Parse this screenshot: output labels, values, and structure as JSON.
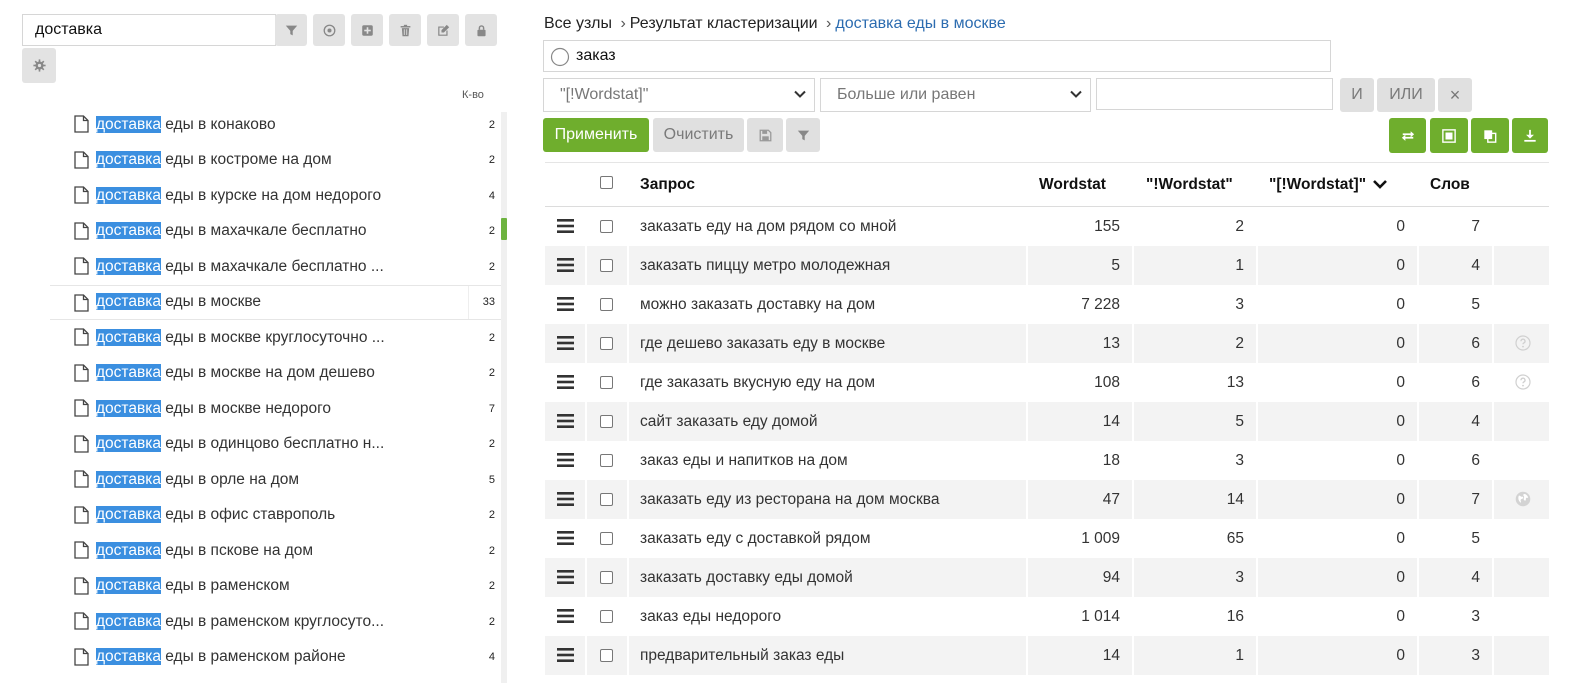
{
  "left_panel": {
    "search_value": "доставка",
    "toolbar_icons": [
      "filter-icon",
      "target-icon",
      "add-icon",
      "trash-icon",
      "edit-icon",
      "lock-icon",
      "gear-icon"
    ],
    "count_header": "К-во",
    "highlight_term": "доставка",
    "items": [
      {
        "rest": " еды в конаково",
        "count": "2"
      },
      {
        "rest": " еды в костроме на дом",
        "count": "2"
      },
      {
        "rest": " еды в курске на дом недорого",
        "count": "4"
      },
      {
        "rest": " еды в махачкале бесплатно",
        "count": "2"
      },
      {
        "rest": " еды в махачкале бесплатно ...",
        "count": "2"
      },
      {
        "rest": " еды в москве",
        "count": "33",
        "selected": true
      },
      {
        "rest": " еды в москве круглосуточно ...",
        "count": "2"
      },
      {
        "rest": " еды в москве на дом дешево",
        "count": "2"
      },
      {
        "rest": " еды в москве недорого",
        "count": "7"
      },
      {
        "rest": " еды в одинцово бесплатно н...",
        "count": "2"
      },
      {
        "rest": " еды в орле на дом",
        "count": "5"
      },
      {
        "rest": " еды в офис ставрополь",
        "count": "2"
      },
      {
        "rest": " еды в пскове на дом",
        "count": "2"
      },
      {
        "rest": " еды в раменском",
        "count": "2"
      },
      {
        "rest": " еды в раменском круглосуто...",
        "count": "2"
      },
      {
        "rest": " еды в раменском районе",
        "count": "4"
      }
    ]
  },
  "breadcrumb": {
    "root": "Все узлы",
    "separator": "›",
    "middle": "Результат кластеризации",
    "current": "доставка еды в москве"
  },
  "search": {
    "value": "заказ"
  },
  "filter": {
    "field_select": "\"[!Wordstat]\"",
    "condition_select": "Больше или равен",
    "value": "",
    "and_label": "И",
    "or_label": "ИЛИ",
    "clear_label": "×"
  },
  "actions": {
    "apply_label": "Применить",
    "clear_label": "Очистить"
  },
  "colors": {
    "accent_green": "#6fae2d",
    "highlight_blue": "#3b8fe0",
    "link_blue": "#2c6cb0"
  },
  "table": {
    "headers": {
      "query": "Запрос",
      "wordstat": "Wordstat",
      "quoted_wordstat": "\"!Wordstat\"",
      "exact_wordstat": "\"[!Wordstat]\"",
      "words": "Слов"
    },
    "sort_column": "exact_wordstat",
    "rows": [
      {
        "query": "заказать еду на дом рядом со мной",
        "wordstat": "155",
        "quoted": "2",
        "exact": "0",
        "words": "7",
        "icon": ""
      },
      {
        "query": "заказать пиццу метро молодежная",
        "wordstat": "5",
        "quoted": "1",
        "exact": "0",
        "words": "4",
        "icon": ""
      },
      {
        "query": "можно заказать доставку на дом",
        "wordstat": "7 228",
        "quoted": "3",
        "exact": "0",
        "words": "5",
        "icon": ""
      },
      {
        "query": "где дешево заказать еду в москве",
        "wordstat": "13",
        "quoted": "2",
        "exact": "0",
        "words": "6",
        "icon": "help-icon"
      },
      {
        "query": "где заказать вкусную еду на дом",
        "wordstat": "108",
        "quoted": "13",
        "exact": "0",
        "words": "6",
        "icon": "help-icon"
      },
      {
        "query": "сайт заказать еду домой",
        "wordstat": "14",
        "quoted": "5",
        "exact": "0",
        "words": "4",
        "icon": ""
      },
      {
        "query": "заказ еды и напитков на дом",
        "wordstat": "18",
        "quoted": "3",
        "exact": "0",
        "words": "6",
        "icon": ""
      },
      {
        "query": "заказать еду из ресторана на дом москва",
        "wordstat": "47",
        "quoted": "14",
        "exact": "0",
        "words": "7",
        "icon": "globe-icon"
      },
      {
        "query": "заказать еду с доставкой рядом",
        "wordstat": "1 009",
        "quoted": "65",
        "exact": "0",
        "words": "5",
        "icon": ""
      },
      {
        "query": "заказать доставку еды домой",
        "wordstat": "94",
        "quoted": "3",
        "exact": "0",
        "words": "4",
        "icon": ""
      },
      {
        "query": "заказ еды недорого",
        "wordstat": "1 014",
        "quoted": "16",
        "exact": "0",
        "words": "3",
        "icon": ""
      },
      {
        "query": "предварительный заказ еды",
        "wordstat": "14",
        "quoted": "1",
        "exact": "0",
        "words": "3",
        "icon": ""
      }
    ]
  }
}
